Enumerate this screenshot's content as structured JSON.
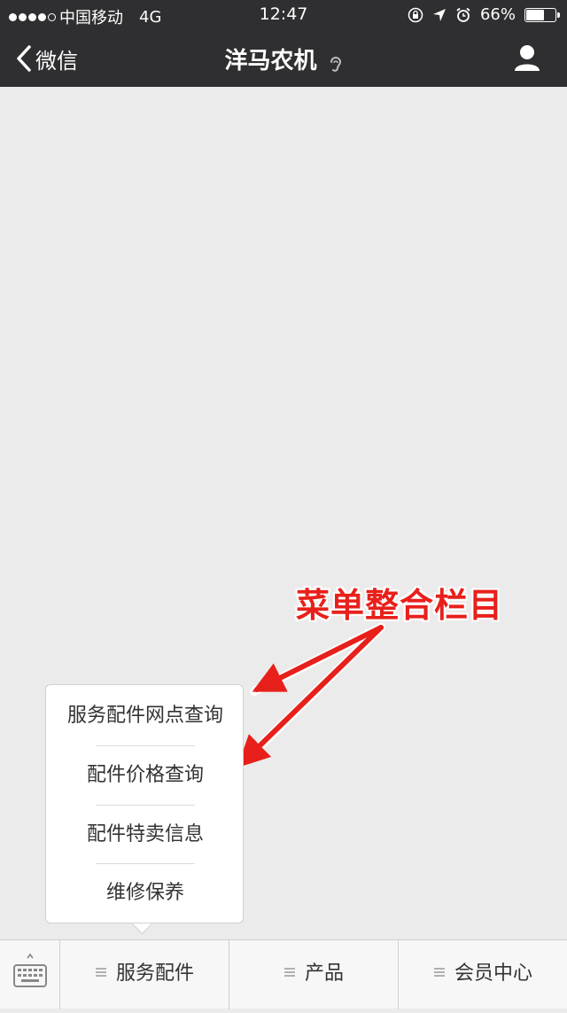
{
  "status_bar": {
    "carrier": "中国移动",
    "network": "4G",
    "time": "12:47",
    "battery": "66%",
    "battery_level": 0.66,
    "icons": [
      "orientation-lock-icon",
      "location-arrow-icon",
      "alarm-icon",
      "battery-icon"
    ]
  },
  "nav": {
    "back_label": "微信",
    "title": "洋马农机",
    "back_icon": "chevron-left-icon",
    "title_icon": "ear-icon",
    "profile_icon": "person-icon"
  },
  "annotation": {
    "text": "菜单整合栏目",
    "color": "#e8201b"
  },
  "submenu": {
    "items": [
      {
        "label": "服务配件网点查询"
      },
      {
        "label": "配件价格查询"
      },
      {
        "label": "配件特卖信息"
      },
      {
        "label": "维修保养"
      }
    ]
  },
  "bottom_menu": {
    "keyboard_icon": "keyboard-icon",
    "tabs": [
      {
        "label": "服务配件"
      },
      {
        "label": "产品"
      },
      {
        "label": "会员中心"
      }
    ]
  },
  "colors": {
    "header_bg": "#2f2f31",
    "content_bg": "#ebebeb",
    "annotation_red": "#e8201b"
  }
}
